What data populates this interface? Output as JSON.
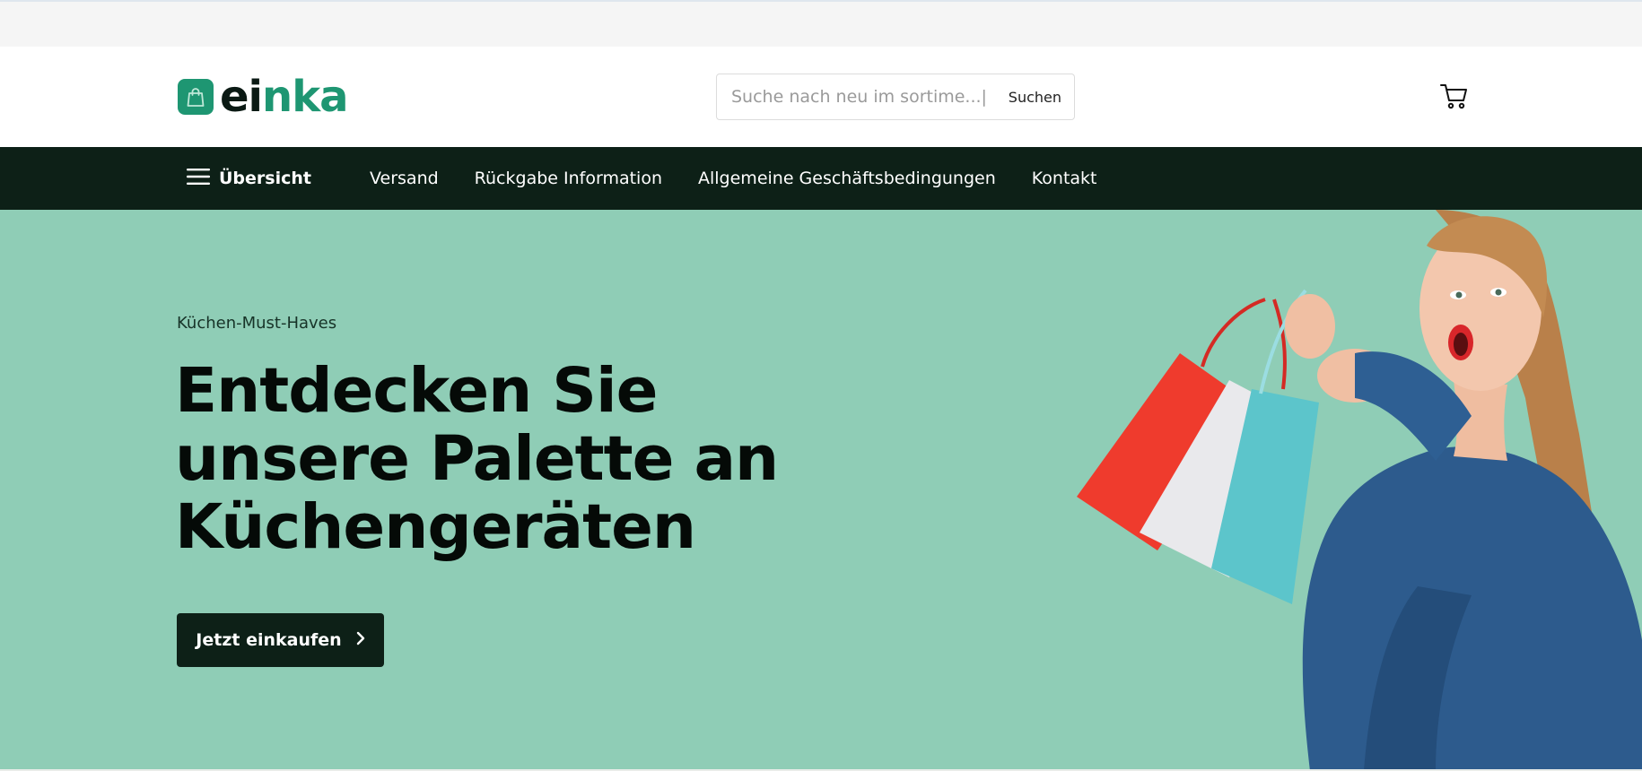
{
  "brand": {
    "logo_part1": "ei",
    "logo_part2": "nka",
    "logo_icon": "shopping-bag-icon",
    "accent_color": "#1e9672",
    "dark_color": "#0d2017"
  },
  "search": {
    "placeholder": "Suche nach neu im sortime...|",
    "button_label": "Suchen"
  },
  "header": {
    "cart_icon": "cart-icon"
  },
  "nav": {
    "menu_label": "Übersicht",
    "menu_icon": "hamburger-icon",
    "links": [
      {
        "label": "Versand"
      },
      {
        "label": "Rückgabe Information"
      },
      {
        "label": "Allgemeine Geschäftsbedingungen"
      },
      {
        "label": "Kontakt"
      }
    ]
  },
  "hero": {
    "eyebrow": "Küchen-Must-Haves",
    "title_line1": "Entdecken Sie",
    "title_line2": "unsere Palette an",
    "title_line3": "Küchengeräten",
    "cta_label": "Jetzt einkaufen",
    "background_color": "#8fcdb6"
  }
}
